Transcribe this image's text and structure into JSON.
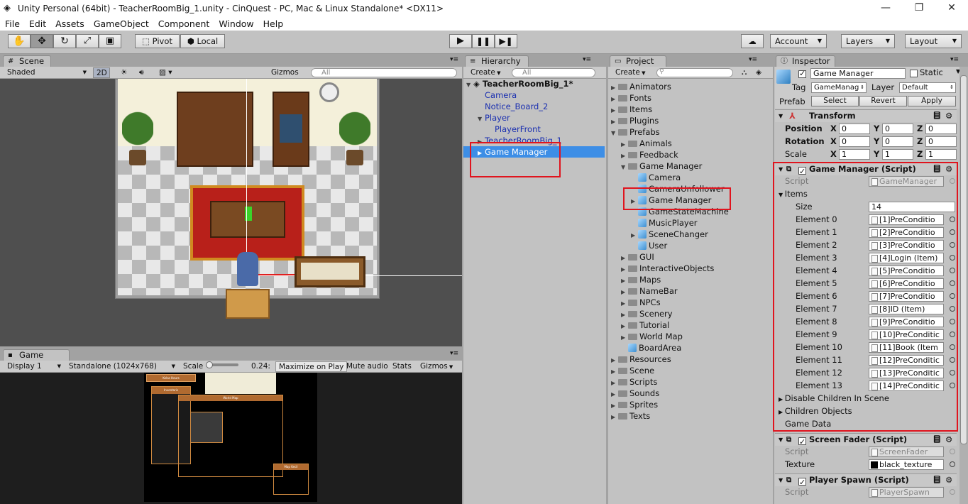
{
  "window": {
    "title": "Unity Personal (64bit) - TeacherRoomBig_1.unity - CinQuest - PC, Mac & Linux Standalone* <DX11>",
    "min": "—",
    "max": "❐",
    "close": "✕"
  },
  "menu": [
    "File",
    "Edit",
    "Assets",
    "GameObject",
    "Component",
    "Window",
    "Help"
  ],
  "toolbar": {
    "pivot": "Pivot",
    "local": "Local",
    "account": "Account",
    "layers": "Layers",
    "layout": "Layout"
  },
  "scene": {
    "tab": "Scene",
    "shaded": "Shaded",
    "mode2d": "2D",
    "gizmos": "Gizmos",
    "search": "All"
  },
  "game": {
    "tab": "Game",
    "display": "Display 1",
    "resolution": "Standalone (1024x768)",
    "scale_label": "Scale",
    "scale_value": "0.24:",
    "maximize": "Maximize on Play",
    "mute": "Mute audio",
    "stats": "Stats",
    "gizmos": "Gizmos"
  },
  "hierarchy": {
    "tab": "Hierarchy",
    "create": "Create",
    "search": "All",
    "scene_name": "TeacherRoomBig_1*",
    "items": [
      "Camera",
      "Notice_Board_2",
      "Player",
      "PlayerFront",
      "TeacherRoomBig_1",
      "Game Manager"
    ]
  },
  "project": {
    "tab": "Project",
    "create": "Create",
    "items": [
      "Animators",
      "Fonts",
      "Items",
      "Plugins",
      "Prefabs",
      "Animals",
      "Feedback",
      "Game Manager",
      "Camera",
      "CameraUnfollower",
      "Game Manager",
      "GameStateMachine",
      "MusicPlayer",
      "SceneChanger",
      "User",
      "GUI",
      "InteractiveObjects",
      "Maps",
      "NameBar",
      "NPCs",
      "Scenery",
      "Tutorial",
      "World Map",
      "BoardArea",
      "Resources",
      "Scene",
      "Scripts",
      "Sounds",
      "Sprites",
      "Texts"
    ]
  },
  "inspector": {
    "tab": "Inspector",
    "object_name": "Game Manager",
    "static": "Static",
    "tag_label": "Tag",
    "tag_value": "GameManag",
    "layer_label": "Layer",
    "layer_value": "Default",
    "prefab_label": "Prefab",
    "select": "Select",
    "revert": "Revert",
    "apply": "Apply",
    "transform": {
      "title": "Transform",
      "rows": [
        {
          "label": "Position",
          "x": "0",
          "y": "0",
          "z": "0"
        },
        {
          "label": "Rotation",
          "x": "0",
          "y": "0",
          "z": "0"
        },
        {
          "label": "Scale",
          "x": "1",
          "y": "1",
          "z": "1"
        }
      ],
      "x": "X",
      "y": "Y",
      "z": "Z"
    },
    "gm": {
      "title": "Game Manager (Script)",
      "script_label": "Script",
      "script_value": "GameManager",
      "items_label": "Items",
      "size_label": "Size",
      "size_value": "14",
      "elements": [
        {
          "label": "Element 0",
          "value": "[1]PreConditio"
        },
        {
          "label": "Element 1",
          "value": "[2]PreConditio"
        },
        {
          "label": "Element 2",
          "value": "[3]PreConditio"
        },
        {
          "label": "Element 3",
          "value": "[4]Login (Item)"
        },
        {
          "label": "Element 4",
          "value": "[5]PreConditio"
        },
        {
          "label": "Element 5",
          "value": "[6]PreConditio"
        },
        {
          "label": "Element 6",
          "value": "[7]PreConditio"
        },
        {
          "label": "Element 7",
          "value": "[8]ID (Item)"
        },
        {
          "label": "Element 8",
          "value": "[9]PreConditio"
        },
        {
          "label": "Element 9",
          "value": "[10]PreConditic"
        },
        {
          "label": "Element 10",
          "value": "[11]Book (Item"
        },
        {
          "label": "Element 11",
          "value": "[12]PreConditic"
        },
        {
          "label": "Element 12",
          "value": "[13]PreConditic"
        },
        {
          "label": "Element 13",
          "value": "[14]PreConditic"
        }
      ],
      "disable_children": "Disable Children In Scene",
      "children_objects": "Children Objects",
      "game_data": "Game Data"
    },
    "fader": {
      "title": "Screen Fader (Script)",
      "script_label": "Script",
      "script_value": "ScreenFader",
      "texture_label": "Texture",
      "texture_value": "black_texture"
    },
    "spawn": {
      "title": "Player Spawn (Script)",
      "script_label": "Script",
      "script_value": "PlayerSpawn"
    }
  },
  "game_hud": {
    "panel1": "Kelas Heurs",
    "panel2": "Inventaris",
    "panel3": "World Map",
    "panel4": "Map Kecil"
  },
  "colors": {
    "selection": "#3d8ee6",
    "highlight": "#e0141e",
    "prefab_text": "#1a2fb0"
  }
}
